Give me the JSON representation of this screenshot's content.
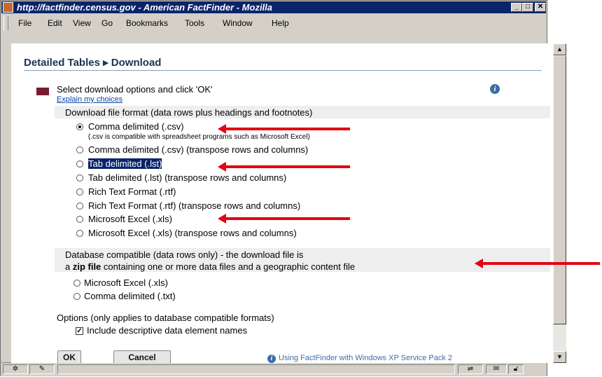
{
  "window": {
    "title": "http://factfinder.census.gov - American FactFinder - Mozilla",
    "min_label": "_",
    "max_label": "□",
    "close_label": "✕"
  },
  "menu": [
    {
      "label": "File"
    },
    {
      "label": "Edit"
    },
    {
      "label": "View"
    },
    {
      "label": "Go"
    },
    {
      "label": "Bookmarks"
    },
    {
      "label": "Tools"
    },
    {
      "label": "Window"
    },
    {
      "label": "Help"
    }
  ],
  "page": {
    "breadcrumb": "Detailed Tables ▸ Download",
    "instruction": "Select download options and click 'OK'",
    "explain_link": "Explain my choices",
    "info_icon": "i"
  },
  "format_section": {
    "heading": "Download file format (data rows plus headings and footnotes)",
    "csv_note": "(.csv is compatible with spreadsheet programs such as Microsoft Excel)",
    "options": [
      {
        "label": "Comma delimited (.csv)",
        "checked": true
      },
      {
        "label": "Comma delimited (.csv) (transpose rows and columns)",
        "checked": false
      },
      {
        "label": "Tab delimited (.lst)",
        "checked": false,
        "highlighted": true
      },
      {
        "label": "Tab delimited (.lst) (transpose rows and columns)",
        "checked": false
      },
      {
        "label": "Rich Text Format (.rtf)",
        "checked": false
      },
      {
        "label": "Rich Text Format (.rtf) (transpose rows and columns)",
        "checked": false
      },
      {
        "label": "Microsoft Excel (.xls)",
        "checked": false
      },
      {
        "label": "Microsoft Excel (.xls) (transpose rows and columns)",
        "checked": false
      }
    ]
  },
  "db_section": {
    "line1": "Database compatible (data rows only) - the download file is",
    "line2_prefix": "a ",
    "line2_bold": "zip file",
    "line2_suffix": " containing one or more data files and a geographic content file",
    "options": [
      {
        "label": "Microsoft Excel (.xls)",
        "checked": false
      },
      {
        "label": "Comma delimited (.txt)",
        "checked": false
      }
    ]
  },
  "options_section": {
    "heading": "Options (only applies to database compatible formats)",
    "checkbox_label": "Include descriptive data element names",
    "checkbox_checked": true,
    "check_mark": "✓"
  },
  "buttons": {
    "ok": "OK",
    "cancel": "Cancel"
  },
  "footer_link": "Using FactFinder with Windows XP Service Pack 2",
  "colors": {
    "arrow": "#e30613",
    "title_bar": "#0a246a",
    "heading": "#1a3552"
  }
}
